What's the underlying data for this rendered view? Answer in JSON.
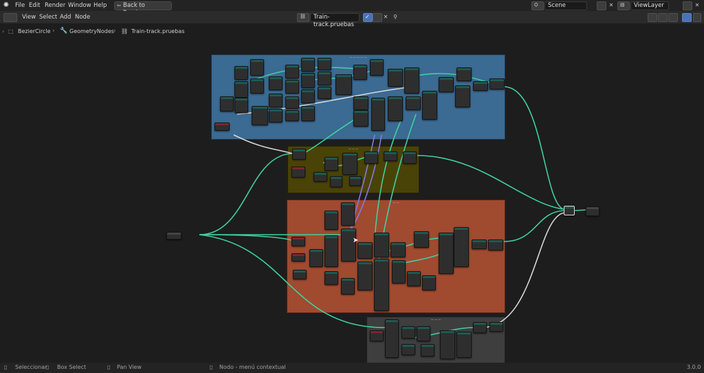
{
  "topbar": {
    "menus": [
      "File",
      "Edit",
      "Render",
      "Window",
      "Help"
    ],
    "back_button": "Back to Previous",
    "scene": "Scene",
    "view_layer": "ViewLayer"
  },
  "editor_header": {
    "menus": [
      "View",
      "Select",
      "Add",
      "Node"
    ],
    "node_tree_name": "Train-track.pruebas"
  },
  "breadcrumb": {
    "items": [
      "BezierCircle",
      "GeometryNodes",
      "Train-track.pruebas"
    ]
  },
  "status_bar": {
    "items": [
      "Seleccionar",
      "Box Select",
      "Pan View",
      "Nodo - menú contextual"
    ],
    "version": "3.0.0"
  },
  "colors": {
    "frame_blue": "#3b6a92",
    "frame_olive": "#4a4308",
    "frame_red": "#a04a30",
    "frame_grey": "#3e3e3e",
    "link_green": "#3fd0a0",
    "link_white": "#d8d8d8",
    "link_purple": "#8a7ae0"
  },
  "icons": {
    "blender_logo": "blender-logo-icon",
    "editor_type": "node-editor-icon",
    "pin": "pin-icon",
    "shield": "shield-icon",
    "close": "close-icon"
  }
}
